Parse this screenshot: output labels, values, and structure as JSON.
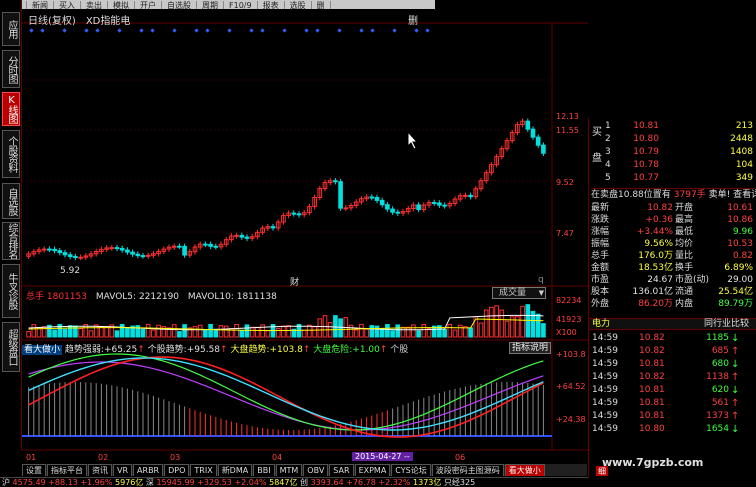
{
  "menu": [
    "板址",
    "新闻",
    "买入",
    "卖出",
    "模拟",
    "开户",
    "自选股",
    "周期",
    "F10/9",
    "报表",
    "选股",
    "删"
  ],
  "left_tabs": [
    {
      "label": "应用",
      "active": false
    },
    {
      "label": "分时图",
      "active": false
    },
    {
      "label": "K线图",
      "active": true
    },
    {
      "label": "个股资料",
      "active": false
    },
    {
      "label": "自选股",
      "active": false
    },
    {
      "label": "综合排名",
      "active": false
    },
    {
      "label": "牛叉诊股",
      "active": false
    },
    {
      "label": "超级盘口",
      "active": false
    }
  ],
  "chart_header": {
    "mode": "日线(复权)",
    "indicator": "XD指能电",
    "right_label": "删"
  },
  "price_axis": {
    "ticks": [
      "12.13",
      "11.55",
      "9.52",
      "7.47"
    ],
    "low_label": "5.92",
    "marker": "财",
    "end_marker": "q"
  },
  "volume": {
    "label": "总手",
    "total": "1801153",
    "mavol5_label": "MAVOL5:",
    "mavol5": "2212190",
    "mavol10_label": "MAVOL10:",
    "mavol10": "1811138",
    "selector": "成交量",
    "axis": [
      "82234",
      "41923",
      "X100"
    ]
  },
  "indicator": {
    "name": "看大做小",
    "s1_label": "趋势强弱:",
    "s1_value": "+65.25",
    "s2_label": "个股趋势:",
    "s2_value": "+95.58",
    "s3_label": "大盘趋势:",
    "s3_value": "+103.8",
    "s4_label": "大盘危险:",
    "s4_value": "+1.00",
    "s5_label": "个股",
    "explain": "指标说明",
    "axis": [
      "+103.8",
      "+64.52",
      "+24.38"
    ]
  },
  "date_axis": {
    "labels": [
      "01",
      "02",
      "03",
      "04",
      "05",
      "06"
    ],
    "highlight": "2015-04-27 --"
  },
  "bottom_tabs": [
    {
      "label": "设置",
      "active": false
    },
    {
      "label": "指标平台",
      "active": false
    },
    {
      "label": "资讯",
      "active": false
    },
    {
      "label": "VR",
      "active": false
    },
    {
      "label": "ARBR",
      "active": false
    },
    {
      "label": "DPO",
      "active": false
    },
    {
      "label": "TRIX",
      "active": false
    },
    {
      "label": "新DMA",
      "active": false
    },
    {
      "label": "BBI",
      "active": false
    },
    {
      "label": "MTM",
      "active": false
    },
    {
      "label": "OBV",
      "active": false
    },
    {
      "label": "SAR",
      "active": false
    },
    {
      "label": "EXPMA",
      "active": false
    },
    {
      "label": "CYS论坛",
      "active": false
    },
    {
      "label": "波段密码主图源码",
      "active": false
    },
    {
      "label": "看大做小",
      "active": true
    }
  ],
  "order_book": {
    "side_label_top": "买",
    "side_label_bottom": "盘",
    "levels": [
      {
        "lvl": "1",
        "price": "10.81",
        "vol": "213"
      },
      {
        "lvl": "2",
        "price": "10.80",
        "vol": "2448"
      },
      {
        "lvl": "3",
        "price": "10.79",
        "vol": "1408"
      },
      {
        "lvl": "4",
        "price": "10.78",
        "vol": "104"
      },
      {
        "lvl": "5",
        "price": "10.77",
        "vol": "349"
      }
    ],
    "sell_info": "在卖盘10.88位置有",
    "sell_hands": "3797手",
    "sell_link": "卖单! 查看详细"
  },
  "summary": [
    {
      "l1": "最新",
      "v1": "10.82",
      "l2": "开盘",
      "v2": "10.61",
      "c1": "red",
      "c2": "red"
    },
    {
      "l1": "涨跌",
      "v1": "+0.36",
      "l2": "最高",
      "v2": "10.86",
      "c1": "red",
      "c2": "red"
    },
    {
      "l1": "涨幅",
      "v1": "+3.44%",
      "l2": "最低",
      "v2": "9.96",
      "c1": "red",
      "c2": "grn"
    },
    {
      "l1": "振幅",
      "v1": "9.56%",
      "l2": "均价",
      "v2": "10.53",
      "c1": "yel",
      "c2": "red"
    },
    {
      "l1": "总手",
      "v1": "176.0万",
      "l2": "量比",
      "v2": "0.82",
      "c1": "yel",
      "c2": "red"
    },
    {
      "l1": "金额",
      "v1": "18.53亿",
      "l2": "换手",
      "v2": "6.89%",
      "c1": "yel",
      "c2": "yel"
    },
    {
      "l1": "市盈",
      "v1": "24.67",
      "l2": "市盈(动)",
      "v2": "29.00",
      "c1": "wht",
      "c2": "wht"
    },
    {
      "l1": "股本",
      "v1": "136.01亿",
      "l2": "流通",
      "v2": "25.54亿",
      "c1": "wht",
      "c2": "yel"
    },
    {
      "l1": "外盘",
      "v1": "86.20万",
      "l2": "内盘",
      "v2": "89.79万",
      "c1": "red",
      "c2": "grn"
    }
  ],
  "ticks_header": {
    "left": "电力",
    "right": "同行业比较"
  },
  "ticks": [
    {
      "time": "14:59",
      "price": "10.82",
      "vol": "1185",
      "dir": "down"
    },
    {
      "time": "14:59",
      "price": "10.82",
      "vol": "685",
      "dir": "up"
    },
    {
      "time": "14:59",
      "price": "10.81",
      "vol": "680",
      "dir": "down"
    },
    {
      "time": "14:59",
      "price": "10.82",
      "vol": "1138",
      "dir": "up"
    },
    {
      "time": "14:59",
      "price": "10.81",
      "vol": "620",
      "dir": "down"
    },
    {
      "time": "14:59",
      "price": "10.81",
      "vol": "561",
      "dir": "up"
    },
    {
      "time": "14:59",
      "price": "10.81",
      "vol": "1373",
      "dir": "up"
    },
    {
      "time": "14:59",
      "price": "10.80",
      "vol": "1654",
      "dir": "down"
    }
  ],
  "watermark": "www.7gpzb.com",
  "corner_btn": "细",
  "status": {
    "s1": "沪",
    "v1": "4575.49",
    "c1": "+88.13",
    "p1": "+1.96%",
    "s2": "5976亿",
    "s3": "深",
    "v3": "15945.99",
    "c3": "+329.53",
    "p3": "+2.04%",
    "s4": "5847亿",
    "s5": "创",
    "v5": "3393.64",
    "c5": "+76.78",
    "p5": "+2.32%",
    "s6": "1373亿",
    "s7": "只经325"
  },
  "colors": {
    "up": "#ff3030",
    "down": "#00e0e0",
    "bg": "#000000",
    "grid": "#600000"
  }
}
